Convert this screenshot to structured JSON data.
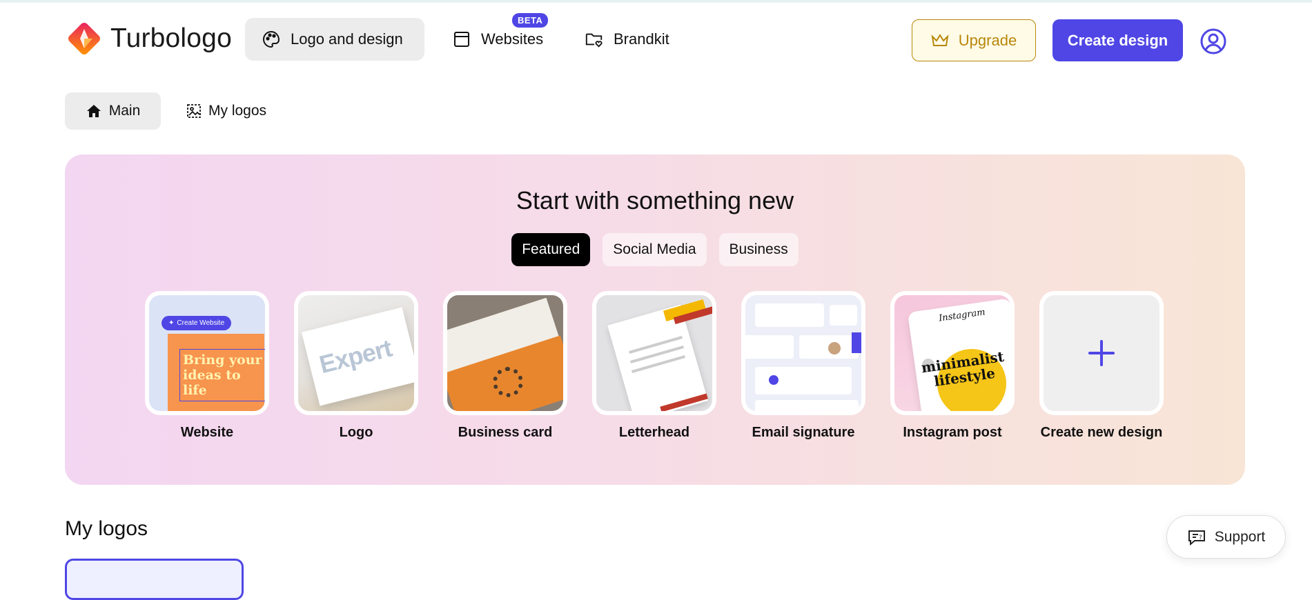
{
  "brand": {
    "name": "Turbologo",
    "accent": "#4f46e5"
  },
  "nav": {
    "items": [
      {
        "label": "Logo and design",
        "icon": "palette-icon",
        "active": true
      },
      {
        "label": "Websites",
        "icon": "browser-window-icon",
        "badge": "BETA"
      },
      {
        "label": "Brandkit",
        "icon": "folder-heart-icon"
      }
    ],
    "upgrade_label": "Upgrade",
    "create_label": "Create design"
  },
  "subnav": {
    "main_label": "Main",
    "mylogos_label": "My logos"
  },
  "hero": {
    "title": "Start with something new",
    "tabs": [
      {
        "label": "Featured",
        "active": true
      },
      {
        "label": "Social Media"
      },
      {
        "label": "Business"
      }
    ],
    "cards": [
      {
        "label": "Website",
        "badge": "Create Website",
        "preview_text": "Bring your ideas to life"
      },
      {
        "label": "Logo",
        "preview_text": "Expert"
      },
      {
        "label": "Business card"
      },
      {
        "label": "Letterhead"
      },
      {
        "label": "Email signature"
      },
      {
        "label": "Instagram post",
        "preview_brand": "Instagram",
        "preview_text": "minimalist lifestyle"
      },
      {
        "label": "Create new design",
        "icon": "plus-icon"
      }
    ]
  },
  "mylogos": {
    "title": "My logos"
  },
  "support": {
    "label": "Support"
  }
}
